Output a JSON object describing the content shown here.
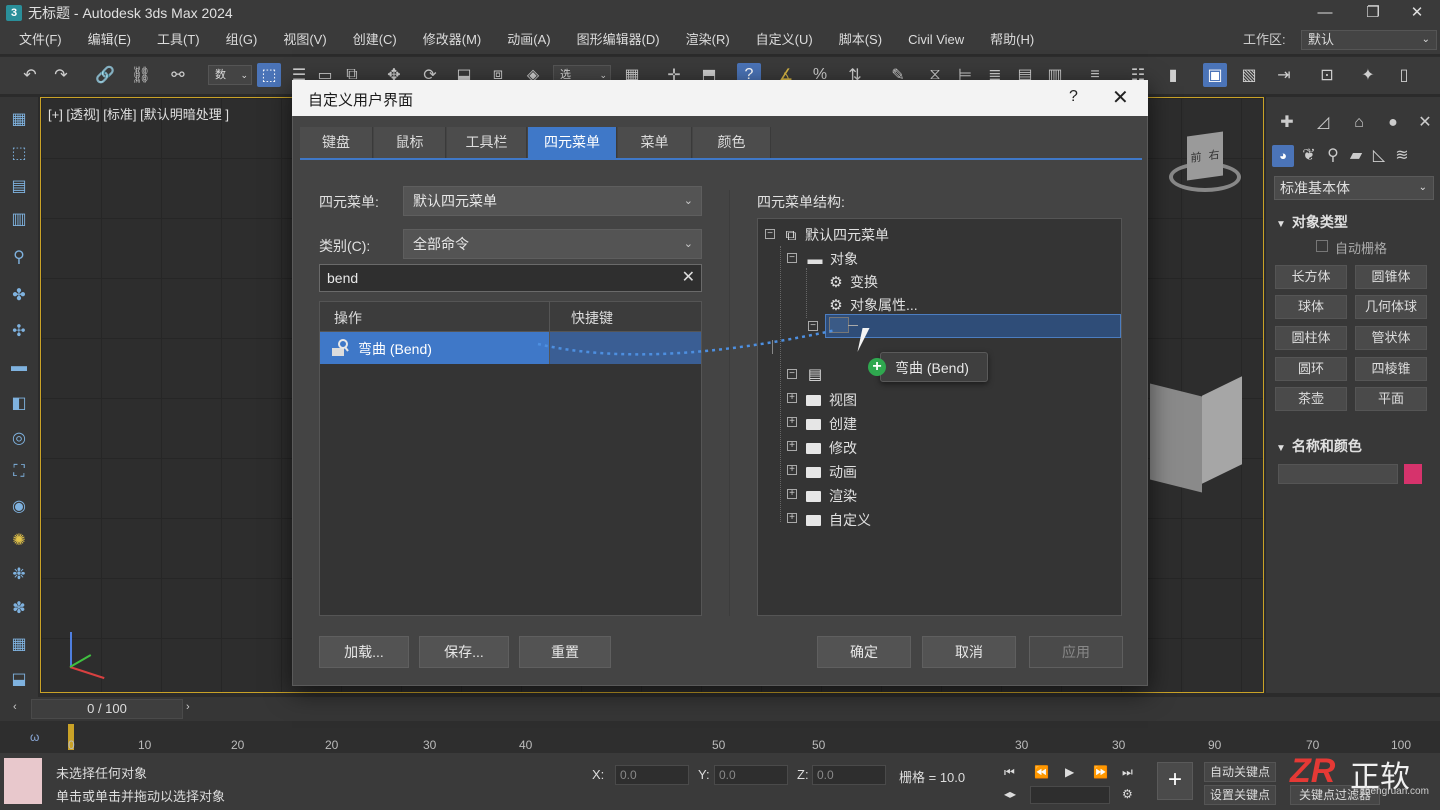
{
  "app": {
    "title": "无标题 - Autodesk 3ds Max 2024",
    "icon_label": "3"
  },
  "menu": [
    "文件(F)",
    "编辑(E)",
    "工具(T)",
    "组(G)",
    "视图(V)",
    "创建(C)",
    "修改器(M)",
    "动画(A)",
    "图形编辑器(D)",
    "渲染(R)",
    "自定义(U)",
    "脚本(S)",
    "Civil View",
    "帮助(H)"
  ],
  "workspace": {
    "label": "工作区:",
    "value": "默认"
  },
  "toolbar": {
    "selection_filter": "数",
    "named_set": "选"
  },
  "viewport": {
    "label": "[+] [透视] [标准] [默认明暗处理 ]",
    "viewcube_front": "前",
    "viewcube_right": "右"
  },
  "command_panel": {
    "dropdown": "标准基本体",
    "section_object_type": "对象类型",
    "autogrid": "自动栅格",
    "buttons": [
      "长方体",
      "圆锥体",
      "球体",
      "几何体球",
      "圆柱体",
      "管状体",
      "圆环",
      "四棱锥",
      "茶壶",
      "平面"
    ],
    "section_name_color": "名称和颜色",
    "object_color": "#d6336c"
  },
  "dialog": {
    "title": "自定义用户界面",
    "help": "?",
    "close": "✕",
    "tabs": [
      "键盘",
      "鼠标",
      "工具栏",
      "四元菜单",
      "菜单",
      "颜色"
    ],
    "active_tab": "四元菜单",
    "quad_label": "四元菜单:",
    "quad_value": "默认四元菜单",
    "category_label": "类别(C):",
    "category_value": "全部命令",
    "search_value": "bend",
    "col_action": "操作",
    "col_shortcut": "快捷键",
    "row_action": "弯曲 (Bend)",
    "structure_label": "四元菜单结构:",
    "tree": {
      "root": "默认四元菜单",
      "object": "对象",
      "transform": "变换",
      "object_props": "对象属性...",
      "view": "视图",
      "create": "创建",
      "modify": "修改",
      "animation": "动画",
      "render": "渲染",
      "customize": "自定义"
    },
    "drop_tip": "弯曲 (Bend)",
    "btn_load": "加载...",
    "btn_save": "保存...",
    "btn_reset": "重置",
    "btn_ok": "确定",
    "btn_cancel": "取消",
    "btn_apply": "应用"
  },
  "timeline": {
    "slider": "0 / 100",
    "ticks": [
      "0",
      "10",
      "20",
      "20",
      "30",
      "40",
      "50",
      "50",
      "30",
      "30",
      "90",
      "70",
      "100"
    ]
  },
  "status": {
    "line1": "未选择任何对象",
    "line2": "单击或单击并拖动以选择对象",
    "x_label": "X:",
    "x_value": "0.0",
    "y_label": "Y:",
    "y_value": "0.0",
    "z_label": "Z:",
    "z_value": "0.0",
    "grid": "栅格 = 10.0",
    "auto_key": "自动关键点",
    "set_key": "设置关键点",
    "key_filter": "关键点过滤器"
  },
  "watermark": {
    "logo": "ZR",
    "brand": "正软",
    "url": "zhengruan.com"
  }
}
